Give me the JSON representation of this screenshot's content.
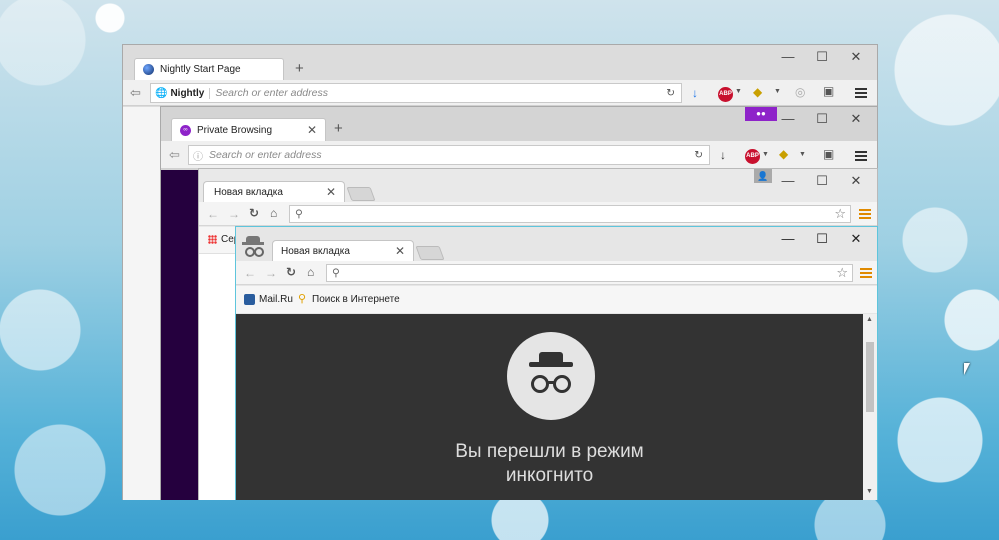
{
  "nightly": {
    "tab_title": "Nightly Start Page",
    "new_tab": "+",
    "identity_label": "Nightly",
    "url_placeholder": "Search or enter address",
    "colors": {
      "frame": "#dcdcdc",
      "toolbar": "#f0f0f0"
    }
  },
  "private": {
    "tab_title": "Private Browsing",
    "new_tab": "+",
    "url_placeholder": "Search or enter address",
    "colors": {
      "mask_badge": "#8e23c9",
      "sidebar": "#25003e"
    }
  },
  "chrome": {
    "tab_title": "Новая вкладка",
    "bookmark_partial": "Сер"
  },
  "incognito": {
    "tab_title": "Новая вкладка",
    "bookmarks": [
      {
        "label": "Mail.Ru"
      },
      {
        "label": "Поиск в Интернете"
      }
    ],
    "heading_line1": "Вы перешли в режим",
    "heading_line2": "инкогнито",
    "colors": {
      "page_bg": "#333333",
      "border": "#5ec5dc"
    }
  },
  "window_controls": {
    "minimize": "—",
    "maximize": "☐",
    "close": "✕"
  }
}
